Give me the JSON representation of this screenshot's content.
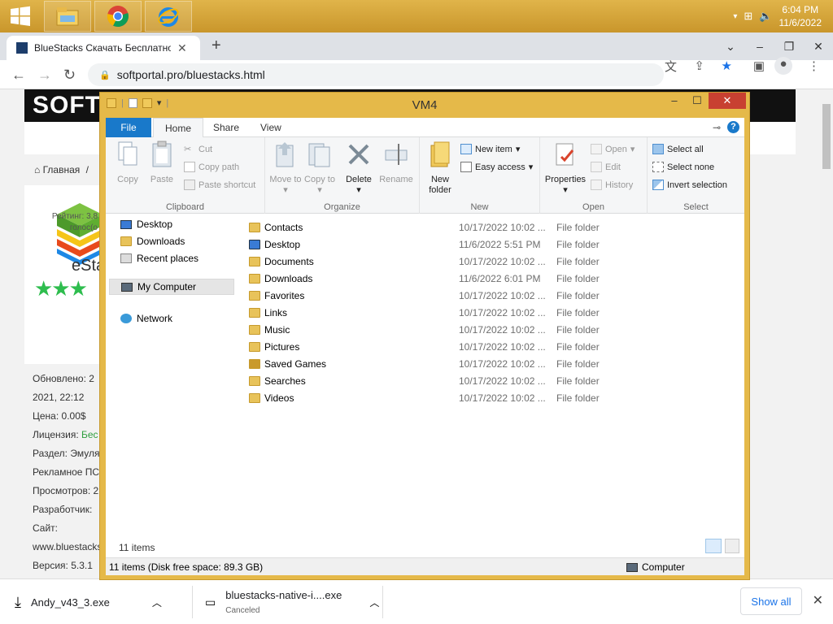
{
  "taskbar": {
    "clock_time": "6:04 PM",
    "clock_date": "11/6/2022"
  },
  "browser": {
    "tab_title": "BlueStacks Скачать Бесплатно на",
    "url": "softportal.pro/bluestacks.html"
  },
  "webpage": {
    "logo_text": "SOFTPO",
    "breadcrumb": "Главная",
    "rating_line1": "Рейтинг: 3,8",
    "rating_line2": "голос(о",
    "info": [
      {
        "label": "Обновлено: 2",
        "value": ""
      },
      {
        "label": "2021, 22:12",
        "value": ""
      },
      {
        "label": "Цена: ",
        "value": "0.00$"
      },
      {
        "label": "Лицензия: ",
        "value": "Бес"
      },
      {
        "label": "Раздел: Эмуля",
        "value": ""
      },
      {
        "label": "Рекламное ПС",
        "value": ""
      },
      {
        "label": "Просмотров: 2",
        "value": ""
      },
      {
        "label": "Разработчик:",
        "value": ""
      },
      {
        "label": "Сайт:",
        "value": ""
      },
      {
        "label": "www.bluestacks",
        "value": ""
      },
      {
        "label": "Версия: 5.3.1",
        "value": ""
      }
    ],
    "logo_partial": "eSta"
  },
  "downloads": {
    "items": [
      {
        "name": "Andy_v43_3.exe",
        "status": ""
      },
      {
        "name": "bluestacks-native-i....exe",
        "status": "Canceled"
      }
    ],
    "show_all": "Show all"
  },
  "explorer": {
    "title": "VM4",
    "tabs": [
      "File",
      "Home",
      "Share",
      "View"
    ],
    "ribbon": {
      "clipboard": {
        "label": "Clipboard",
        "copy": "Copy",
        "paste": "Paste",
        "cut": "Cut",
        "copy_path": "Copy path",
        "paste_shortcut": "Paste shortcut"
      },
      "organize": {
        "label": "Organize",
        "move_to": "Move to",
        "copy_to": "Copy to",
        "delete": "Delete",
        "rename": "Rename"
      },
      "new": {
        "label": "New",
        "new_folder_1": "New",
        "new_folder_2": "folder",
        "new_item": "New item",
        "easy_access": "Easy access"
      },
      "open": {
        "label": "Open",
        "properties": "Properties",
        "open": "Open",
        "edit": "Edit",
        "history": "History"
      },
      "select": {
        "label": "Select",
        "select_all": "Select all",
        "select_none": "Select none",
        "invert_selection": "Invert selection"
      }
    },
    "nav": {
      "desktop": "Desktop",
      "downloads": "Downloads",
      "recent": "Recent places",
      "my_computer": "My Computer",
      "network": "Network"
    },
    "files": [
      {
        "name": "Contacts",
        "date": "10/17/2022 10:02 ...",
        "type": "File folder"
      },
      {
        "name": "Desktop",
        "date": "11/6/2022 5:51 PM",
        "type": "File folder"
      },
      {
        "name": "Documents",
        "date": "10/17/2022 10:02 ...",
        "type": "File folder"
      },
      {
        "name": "Downloads",
        "date": "11/6/2022 6:01 PM",
        "type": "File folder"
      },
      {
        "name": "Favorites",
        "date": "10/17/2022 10:02 ...",
        "type": "File folder"
      },
      {
        "name": "Links",
        "date": "10/17/2022 10:02 ...",
        "type": "File folder"
      },
      {
        "name": "Music",
        "date": "10/17/2022 10:02 ...",
        "type": "File folder"
      },
      {
        "name": "Pictures",
        "date": "10/17/2022 10:02 ...",
        "type": "File folder"
      },
      {
        "name": "Saved Games",
        "date": "10/17/2022 10:02 ...",
        "type": "File folder"
      },
      {
        "name": "Searches",
        "date": "10/17/2022 10:02 ...",
        "type": "File folder"
      },
      {
        "name": "Videos",
        "date": "10/17/2022 10:02 ...",
        "type": "File folder"
      }
    ],
    "items_count": "11 items",
    "status_left": "11 items (Disk free space: 89.3 GB)",
    "status_right": "Computer"
  },
  "colors": {
    "taskbar": "#d8a63a",
    "window_frame": "#e5b949",
    "file_tab": "#1979ca",
    "close_btn": "#c84031",
    "stars": "#2ebd4e"
  }
}
